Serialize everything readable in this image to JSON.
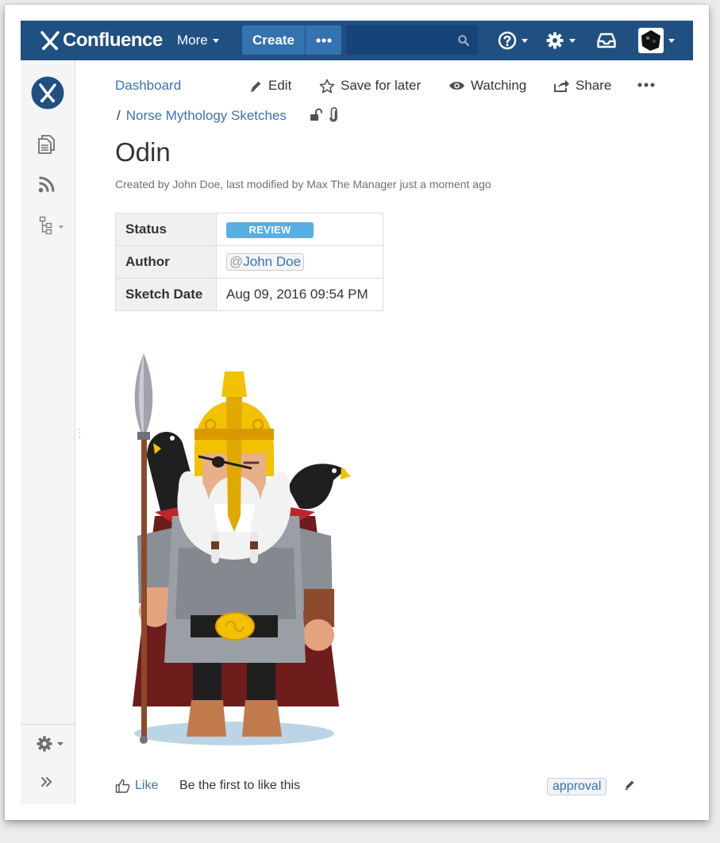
{
  "app": {
    "name": "Confluence"
  },
  "topnav": {
    "more_label": "More",
    "create_label": "Create",
    "search_value": ""
  },
  "breadcrumb": {
    "dashboard": "Dashboard",
    "separator": "/",
    "space": "Norse Mythology Sketches"
  },
  "actions": {
    "edit": "Edit",
    "save_for_later": "Save for later",
    "watching": "Watching",
    "share": "Share"
  },
  "page": {
    "title": "Odin",
    "byline": "Created by John Doe, last modified by Max The Manager just a moment ago"
  },
  "properties": [
    {
      "key": "Status",
      "value": "REVIEW"
    },
    {
      "key": "Author",
      "value": "John Doe"
    },
    {
      "key": "Sketch Date",
      "value": "Aug 09, 2016 09:54 PM"
    }
  ],
  "mention_prefix": "@",
  "footer": {
    "like_label": "Like",
    "like_message": "Be the first to like this",
    "label": "approval"
  },
  "colors": {
    "nav_bg": "#205081",
    "button_blue": "#3572b0",
    "link": "#3b73af",
    "status_lozenge": "#59afe1"
  },
  "icons": {
    "logo": "confluence-logo-icon",
    "help": "help-icon",
    "settings": "gear-icon",
    "notifications": "inbox-icon",
    "search": "search-icon",
    "edit": "pencil-icon",
    "save": "star-icon",
    "watch": "eye-icon",
    "share": "share-icon",
    "restrictions": "unlock-icon",
    "attachments": "paperclip-icon",
    "like": "thumbs-up-icon"
  }
}
